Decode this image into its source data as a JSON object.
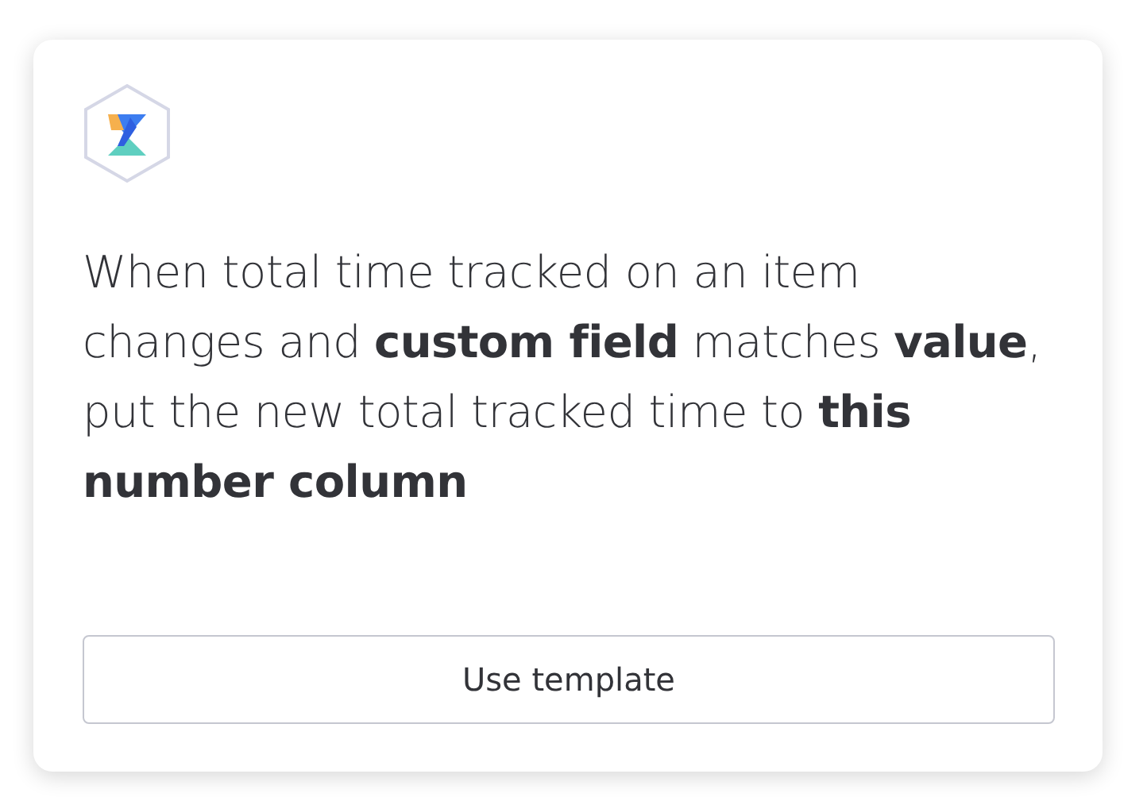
{
  "description": "When total time tracked on an item changes and **custom field** matches **value**, put the new total tracked time to **this number column**",
  "button": "Use template"
}
